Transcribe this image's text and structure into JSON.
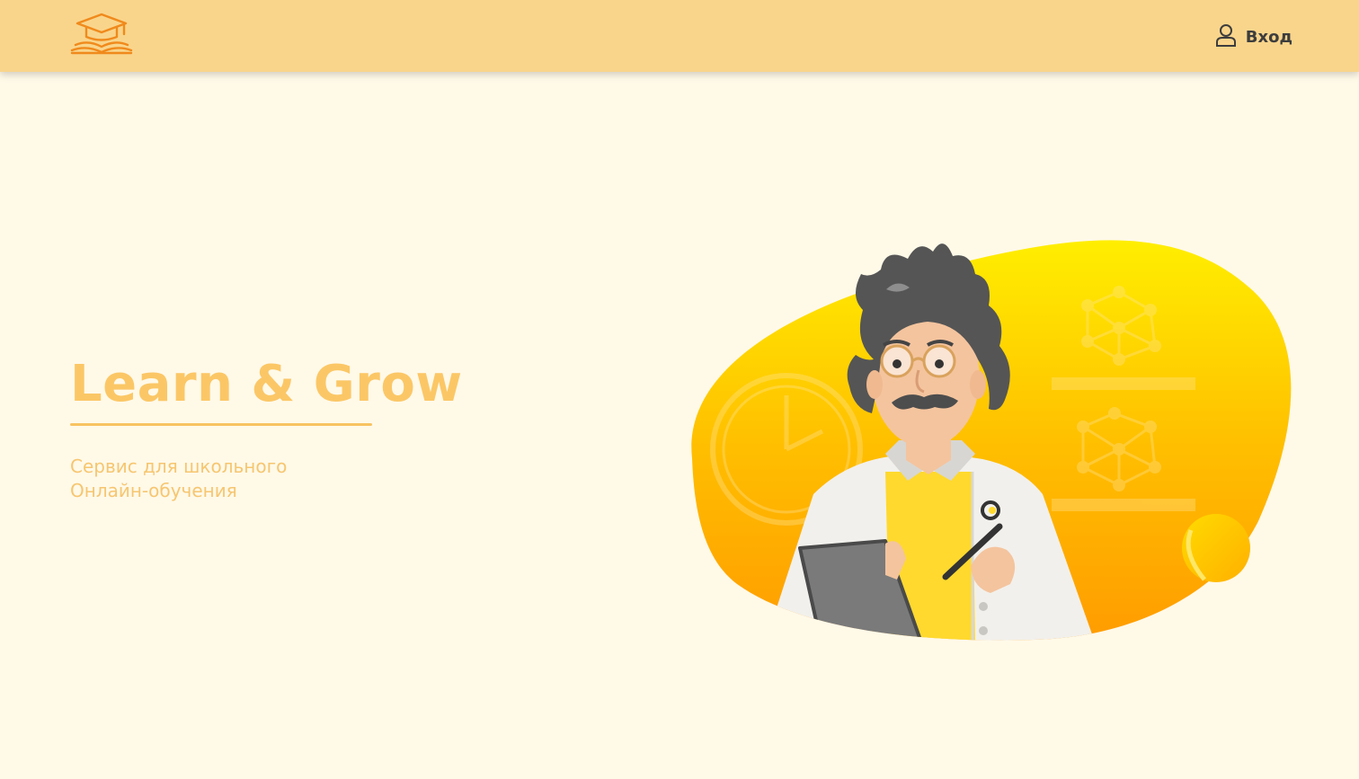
{
  "header": {
    "logo_icon": "graduation-cap-book-icon",
    "login_icon": "user-icon",
    "login_label": "Вход"
  },
  "hero": {
    "title": "Learn & Grow",
    "subtitle_line1": "Сервис для школьного",
    "subtitle_line2": "Онлайн-обучения",
    "illustration": "teacher-scientist-illustration"
  },
  "colors": {
    "header_bg": "#f9d58b",
    "page_bg": "#fff9e8",
    "accent": "#fbc766",
    "logo": "#f08a1c",
    "blob_top": "#ffe600",
    "blob_bottom": "#ffa200"
  }
}
